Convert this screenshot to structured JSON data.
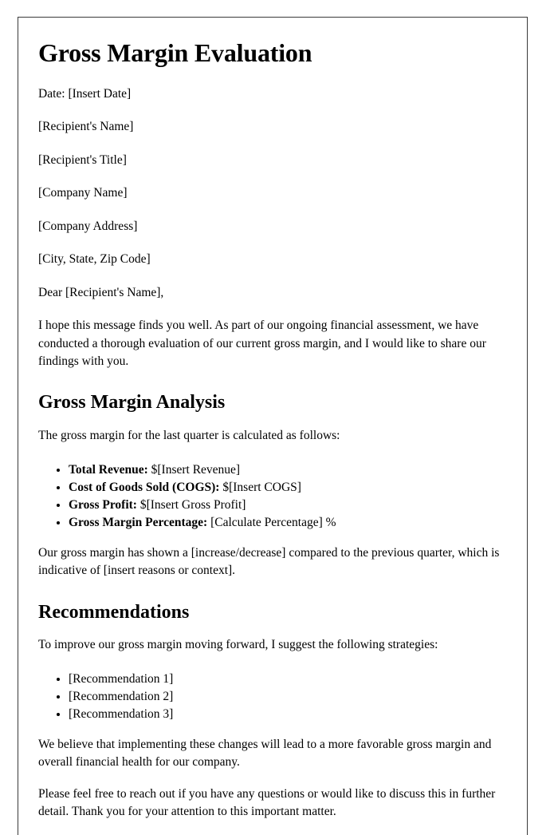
{
  "document": {
    "title": "Gross Margin Evaluation",
    "date_line": "Date: [Insert Date]",
    "recipient_block": [
      "[Recipient's Name]",
      "[Recipient's Title]",
      "[Company Name]",
      "[Company Address]",
      "[City, State, Zip Code]"
    ],
    "salutation": "Dear [Recipient's Name],",
    "opening_paragraph": "I hope this message finds you well. As part of our ongoing financial assessment, we have conducted a thorough evaluation of our current gross margin, and I would like to share our findings with you.",
    "sections": [
      {
        "heading": "Gross Margin Analysis",
        "intro": "The gross margin for the last quarter is calculated as follows:",
        "items": [
          {
            "label": "Total Revenue:",
            "value": "$[Insert Revenue]"
          },
          {
            "label": "Cost of Goods Sold (COGS):",
            "value": "$[Insert COGS]"
          },
          {
            "label": "Gross Profit:",
            "value": "$[Insert Gross Profit]"
          },
          {
            "label": "Gross Margin Percentage:",
            "value": "[Calculate Percentage] %"
          }
        ],
        "closing": "Our gross margin has shown a [increase/decrease] compared to the previous quarter, which is indicative of [insert reasons or context]."
      },
      {
        "heading": "Recommendations",
        "intro": "To improve our gross margin moving forward, I suggest the following strategies:",
        "items": [
          {
            "label": "",
            "value": "[Recommendation 1]"
          },
          {
            "label": "",
            "value": "[Recommendation 2]"
          },
          {
            "label": "",
            "value": "[Recommendation 3]"
          }
        ],
        "closing": "We believe that implementing these changes will lead to a more favorable gross margin and overall financial health for our company."
      }
    ],
    "final_paragraph": "Please feel free to reach out if you have any questions or would like to discuss this in further detail. Thank you for your attention to this important matter."
  },
  "colors": {
    "page_background": "#ffffff",
    "page_border": "#3a3a3a",
    "text": "#000000"
  }
}
